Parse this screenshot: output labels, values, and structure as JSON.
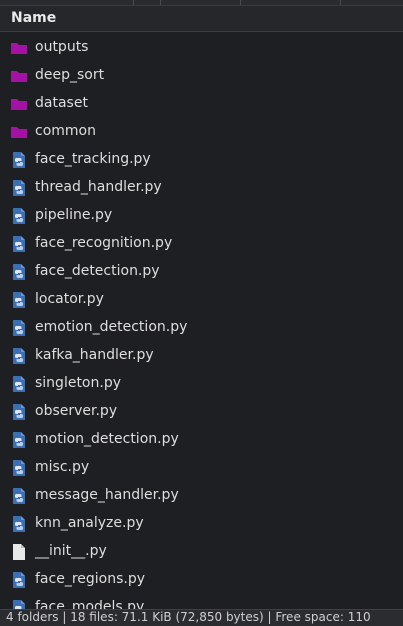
{
  "header": {
    "name_label": "Name"
  },
  "files": [
    {
      "name": "outputs",
      "kind": "folder"
    },
    {
      "name": "deep_sort",
      "kind": "folder"
    },
    {
      "name": "dataset",
      "kind": "folder"
    },
    {
      "name": "common",
      "kind": "folder"
    },
    {
      "name": "face_tracking.py",
      "kind": "python"
    },
    {
      "name": "thread_handler.py",
      "kind": "python"
    },
    {
      "name": "pipeline.py",
      "kind": "python"
    },
    {
      "name": "face_recognition.py",
      "kind": "python"
    },
    {
      "name": "face_detection.py",
      "kind": "python"
    },
    {
      "name": "locator.py",
      "kind": "python"
    },
    {
      "name": "emotion_detection.py",
      "kind": "python"
    },
    {
      "name": "kafka_handler.py",
      "kind": "python"
    },
    {
      "name": "singleton.py",
      "kind": "python"
    },
    {
      "name": "observer.py",
      "kind": "python"
    },
    {
      "name": "motion_detection.py",
      "kind": "python"
    },
    {
      "name": "misc.py",
      "kind": "python"
    },
    {
      "name": "message_handler.py",
      "kind": "python"
    },
    {
      "name": "knn_analyze.py",
      "kind": "python"
    },
    {
      "name": "__init__.py",
      "kind": "blank"
    },
    {
      "name": "face_regions.py",
      "kind": "python"
    },
    {
      "name": "face_models.py",
      "kind": "python"
    }
  ],
  "status_bar": {
    "text": "4 folders | 18 files: 71.1 KiB (72,850 bytes) | Free space: 110"
  },
  "colors": {
    "folder": "#a512a5",
    "python_body": "#3b6fb4",
    "python_mark": "#dfe6f0",
    "blank_file": "#e8e8e8"
  }
}
